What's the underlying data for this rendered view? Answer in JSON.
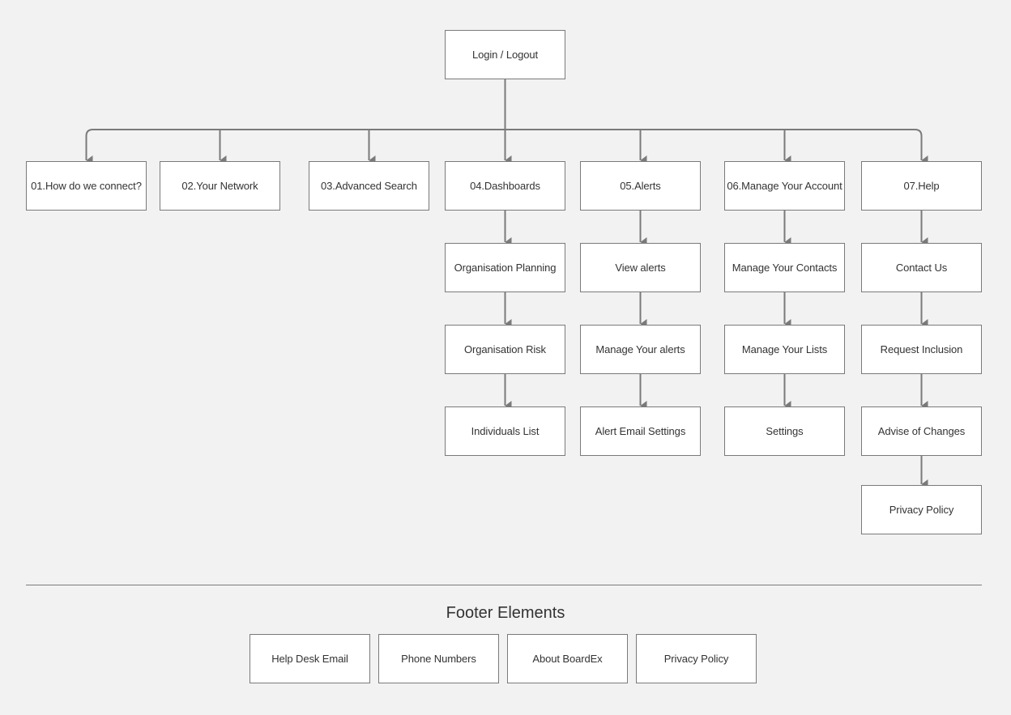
{
  "root": {
    "label": "Login / Logout"
  },
  "sections": [
    {
      "label": "01.How do we connect?",
      "children": []
    },
    {
      "label": "02.Your Network",
      "children": []
    },
    {
      "label": "03.Advanced Search",
      "children": []
    },
    {
      "label": "04.Dashboards",
      "children": [
        "Organisation Planning",
        "Organisation Risk",
        "Individuals List"
      ]
    },
    {
      "label": "05.Alerts",
      "children": [
        "View alerts",
        "Manage Your alerts",
        "Alert Email Settings"
      ]
    },
    {
      "label": "06.Manage Your Account",
      "children": [
        "Manage Your Contacts",
        "Manage Your Lists",
        "Settings"
      ]
    },
    {
      "label": "07.Help",
      "children": [
        "Contact Us",
        "Request Inclusion",
        "Advise of Changes",
        "Privacy Policy"
      ]
    }
  ],
  "footer": {
    "title": "Footer Elements",
    "items": [
      "Help Desk Email",
      "Phone Numbers",
      "About BoardEx",
      "Privacy Policy"
    ]
  },
  "colors": {
    "line": "#7a7a7a",
    "box_fill": "#ffffff",
    "background": "#f2f2f2"
  }
}
